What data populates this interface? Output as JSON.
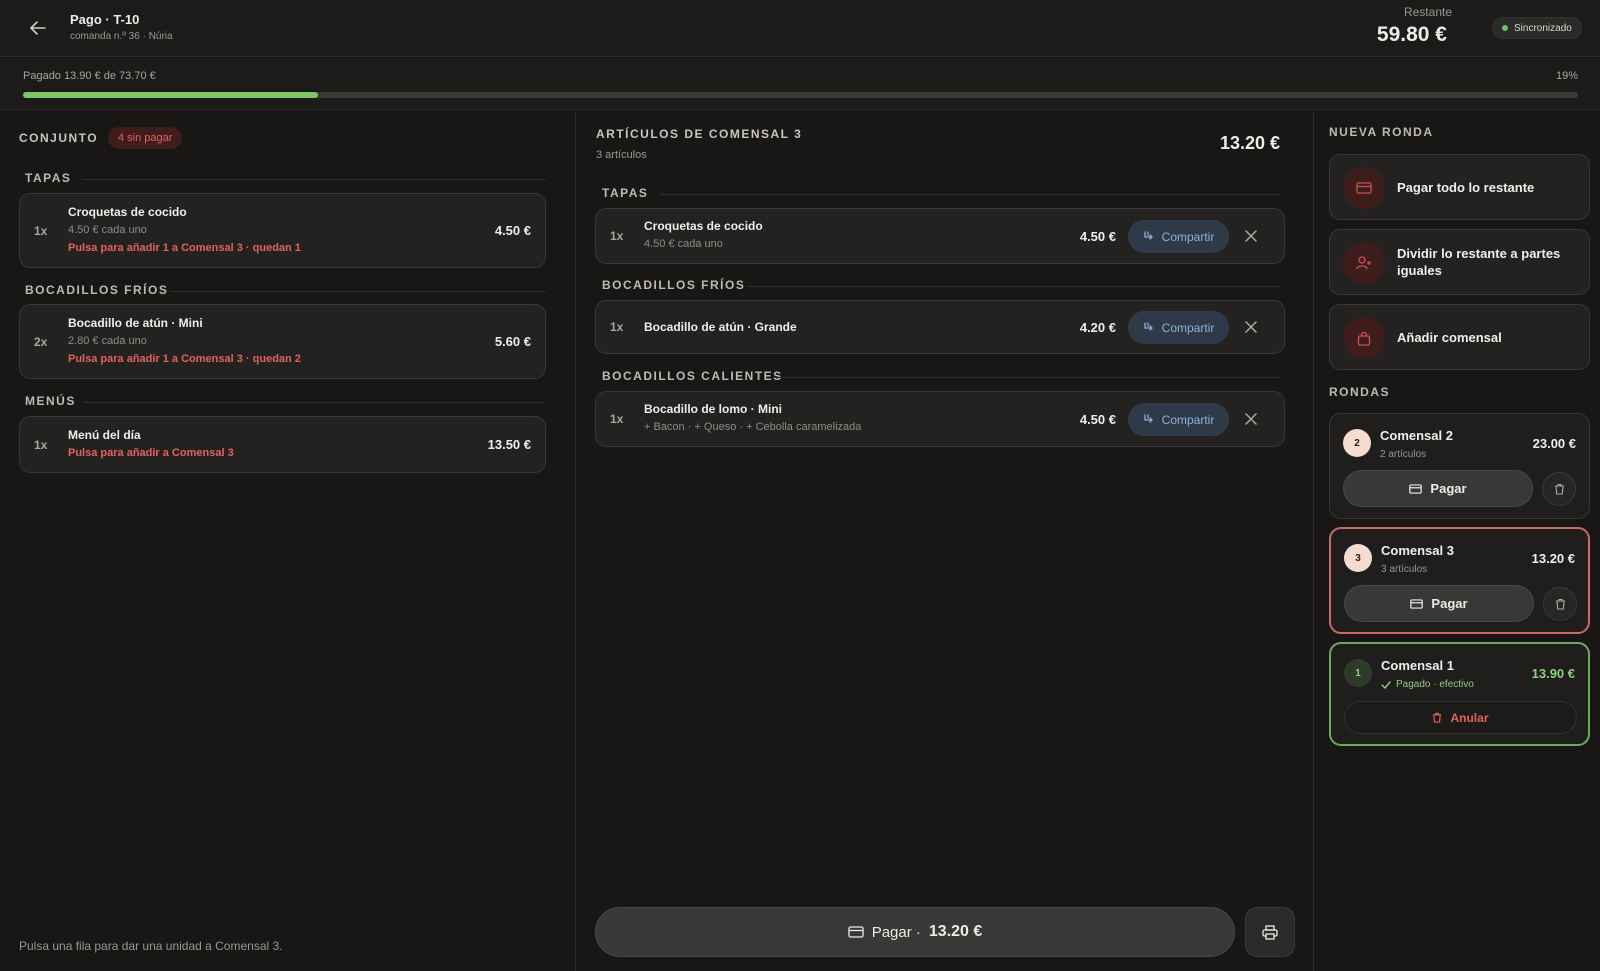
{
  "header": {
    "title": "Pago · T-10",
    "subtitle": "comanda n.º 36 · Núria",
    "restante_label": "Restante",
    "restante_value": "59.80 €",
    "sync_label": "Sincronizado"
  },
  "progress": {
    "text": "Pagado 13.90 € de 73.70 €",
    "percent_label": "19%",
    "fraction": 0.19
  },
  "left": {
    "title": "CONJUNTO",
    "unpaid_badge": "4 sin pagar",
    "sections": [
      {
        "heading": "TAPAS",
        "items": [
          {
            "qty": "1x",
            "name": "Croquetas de cocido",
            "unit": "4.50 € cada uno",
            "hint": "Pulsa para añadir 1 a Comensal 3 · quedan 1",
            "price": "4.50 €"
          }
        ]
      },
      {
        "heading": "BOCADILLOS FRÍOS",
        "items": [
          {
            "qty": "2x",
            "name": "Bocadillo de atún · Mini",
            "unit": "2.80 € cada uno",
            "hint": "Pulsa para añadir 1 a Comensal 3 · quedan 2",
            "price": "5.60 €"
          }
        ]
      },
      {
        "heading": "MENÚS",
        "items": [
          {
            "qty": "1x",
            "name": "Menú del día",
            "hint": "Pulsa para añadir a Comensal 3",
            "price": "13.50 €"
          }
        ]
      }
    ],
    "footer": "Pulsa una fila para dar una unidad a Comensal 3."
  },
  "middle": {
    "title": "ARTÍCULOS DE COMENSAL 3",
    "count": "3 artículos",
    "total": "13.20 €",
    "share_label": "Compartir",
    "sections": [
      {
        "heading": "TAPAS",
        "items": [
          {
            "qty": "1x",
            "name": "Croquetas de cocido",
            "sub": "4.50 € cada uno",
            "price": "4.50 €"
          }
        ]
      },
      {
        "heading": "BOCADILLOS FRÍOS",
        "items": [
          {
            "qty": "1x",
            "name": "Bocadillo de atún · Grande",
            "price": "4.20 €"
          }
        ]
      },
      {
        "heading": "BOCADILLOS CALIENTES",
        "items": [
          {
            "qty": "1x",
            "name": "Bocadillo de lomo · Mini",
            "sub": "+ Bacon · + Queso · + Cebolla caramelizada",
            "price": "4.50 €"
          }
        ]
      }
    ],
    "pay_label": "Pagar ·",
    "pay_amount": "13.20 €"
  },
  "right": {
    "new_round_heading": "NUEVA RONDA",
    "actions": [
      {
        "label": "Pagar todo lo restante",
        "icon": "card-icon"
      },
      {
        "label": "Dividir lo restante a partes iguales",
        "icon": "user-plus-icon"
      },
      {
        "label": "Añadir comensal",
        "icon": "bag-icon"
      }
    ],
    "rounds_heading": "RONDAS",
    "rounds": [
      {
        "num": "2",
        "name": "Comensal 2",
        "sub": "2 artículos",
        "total": "23.00 €",
        "pay_label": "Pagar"
      },
      {
        "num": "3",
        "name": "Comensal 3",
        "sub": "3 artículos",
        "total": "13.20 €",
        "pay_label": "Pagar"
      },
      {
        "num": "1",
        "name": "Comensal 1",
        "sub": "Pagado · efectivo",
        "total": "13.90 €",
        "void_label": "Anular"
      }
    ]
  },
  "colors": {
    "accent_red": "#e0625e",
    "accent_green": "#7fc66b",
    "share_blue": "#8fb1d8"
  }
}
